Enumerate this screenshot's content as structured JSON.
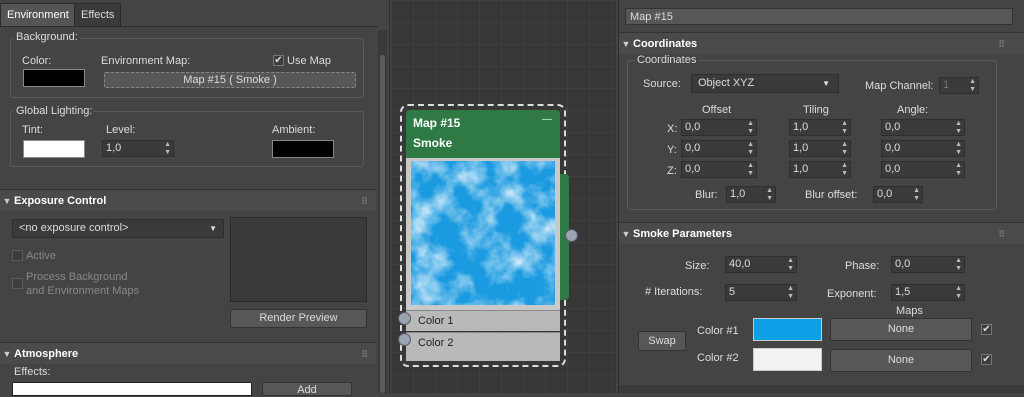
{
  "left": {
    "tabs": [
      "Environment",
      "Effects"
    ],
    "background": {
      "legend": "Background:",
      "color_label": "Color:",
      "env_map_label": "Environment Map:",
      "use_map_label": "Use Map",
      "use_map_checked": true,
      "map_button": "Map #15  ( Smoke )",
      "color_value": "#000000"
    },
    "global_lighting": {
      "legend": "Global Lighting:",
      "tint_label": "Tint:",
      "level_label": "Level:",
      "level_value": "1,0",
      "ambient_label": "Ambient:",
      "tint_value": "#ffffff",
      "ambient_value": "#000000"
    },
    "exposure": {
      "title": "Exposure Control",
      "dropdown": "<no exposure control>",
      "active_label": "Active",
      "process_label_1": "Process Background",
      "process_label_2": "and Environment Maps",
      "render_preview": "Render Preview"
    },
    "atmosphere": {
      "title": "Atmosphere",
      "effects_label": "Effects:",
      "add_button": "Add"
    }
  },
  "node": {
    "title": "Map #15",
    "subtitle": "Smoke",
    "minimize": "—",
    "sockets": [
      "Color 1",
      "Color 2"
    ]
  },
  "right": {
    "map_name": "Map #15",
    "coordinates": {
      "title": "Coordinates",
      "legend": "Coordinates",
      "source_label": "Source:",
      "source_value": "Object XYZ",
      "map_channel_label": "Map Channel:",
      "map_channel_value": "1",
      "col_offset": "Offset",
      "col_tiling": "Tiling",
      "col_angle": "Angle:",
      "rows": [
        {
          "axis": "X:",
          "offset": "0,0",
          "tiling": "1,0",
          "angle": "0,0"
        },
        {
          "axis": "Y:",
          "offset": "0,0",
          "tiling": "1,0",
          "angle": "0,0"
        },
        {
          "axis": "Z:",
          "offset": "0,0",
          "tiling": "1,0",
          "angle": "0,0"
        }
      ],
      "blur_label": "Blur:",
      "blur_value": "1,0",
      "blur_offset_label": "Blur offset:",
      "blur_offset_value": "0,0"
    },
    "smoke": {
      "title": "Smoke Parameters",
      "size_label": "Size:",
      "size_value": "40,0",
      "phase_label": "Phase:",
      "phase_value": "0,0",
      "iterations_label": "# Iterations:",
      "iterations_value": "5",
      "exponent_label": "Exponent:",
      "exponent_value": "1,5",
      "maps_label": "Maps",
      "swap_button": "Swap",
      "color1_label": "Color #1",
      "color2_label": "Color #2",
      "color1_value": "#0ea0e6",
      "color2_value": "#f2f2f2",
      "map1_button": "None",
      "map2_button": "None"
    }
  }
}
